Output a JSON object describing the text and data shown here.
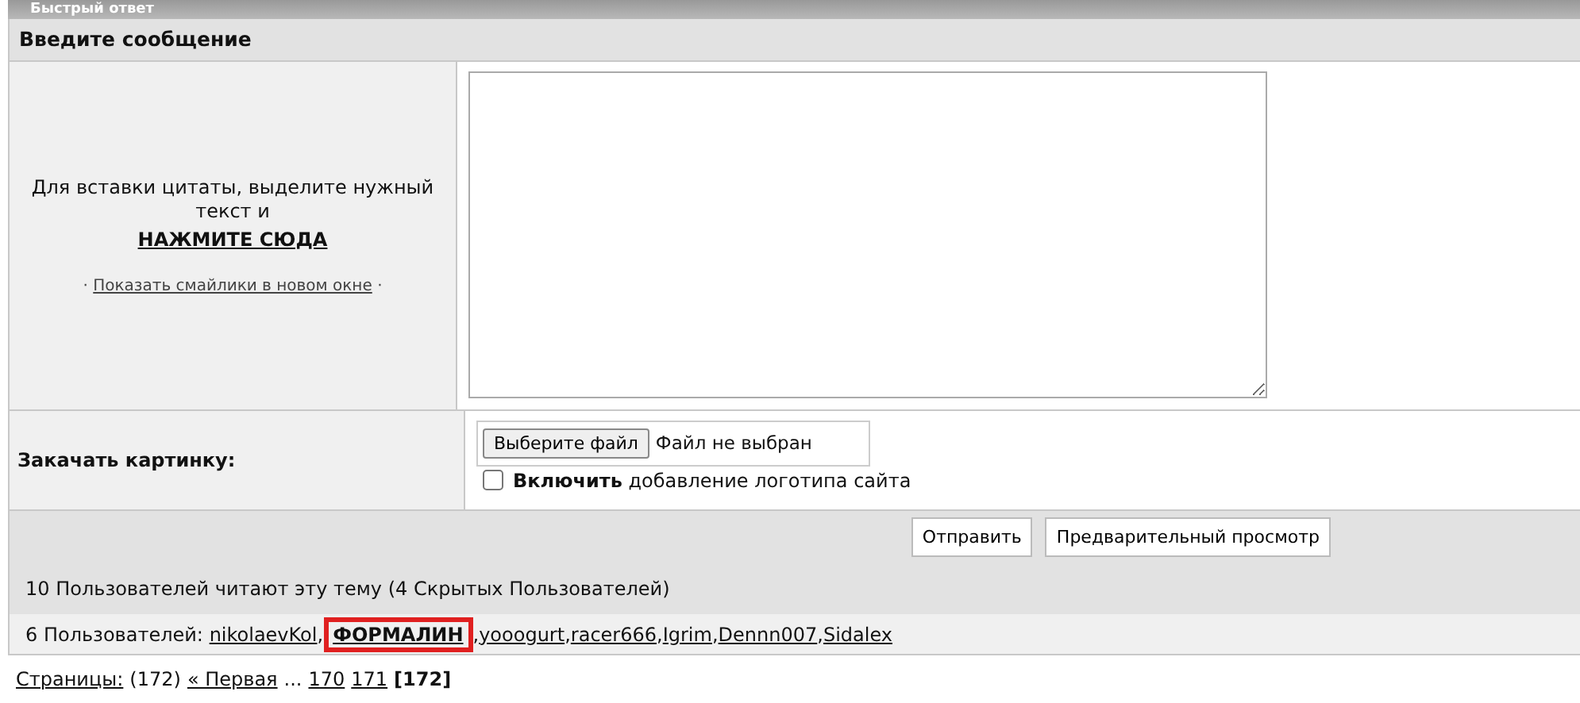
{
  "panel_title": "Быстрый ответ",
  "section_title": "Введите сообщение",
  "quote_hint": {
    "text": "Для вставки цитаты, выделите нужный текст и",
    "link": "НАЖМИТЕ СЮДА"
  },
  "smilies_link": {
    "before": "·",
    "text": "Показать смайлики в новом окне",
    "after": "·"
  },
  "upload": {
    "label": "Закачать картинку:",
    "file_button": "Выберите файл",
    "file_status": "Файл не выбран",
    "logo_option": {
      "text": "**Включить** добавление логотипа сайта",
      "checked": false
    }
  },
  "buttons": [
    "Отправить",
    "Предварительный просмотр"
  ],
  "readers": {
    "title": "10 Пользователей читают эту тему (4 Скрытых Пользователей)",
    "label": "6 Пользователей:",
    "separator": ",",
    "users": [
      {
        "name": "nikolaevKol",
        "highlighted": false
      },
      {
        "name": "ФОРМАЛИН",
        "highlighted": true
      },
      {
        "name": "yooogurt",
        "highlighted": false
      },
      {
        "name": "racer666",
        "highlighted": false
      },
      {
        "name": "Igrim",
        "highlighted": false
      },
      {
        "name": "Dennn007",
        "highlighted": false
      },
      {
        "name": "Sidalex",
        "highlighted": false
      }
    ]
  },
  "pagination": {
    "label": "Страницы:",
    "count": "(172)",
    "first": "« Первая",
    "ellipsis": "...",
    "pages": [
      {
        "label": "170",
        "selected": false
      },
      {
        "label": "171",
        "selected": false
      },
      {
        "label": "[172]",
        "selected": true
      }
    ]
  }
}
